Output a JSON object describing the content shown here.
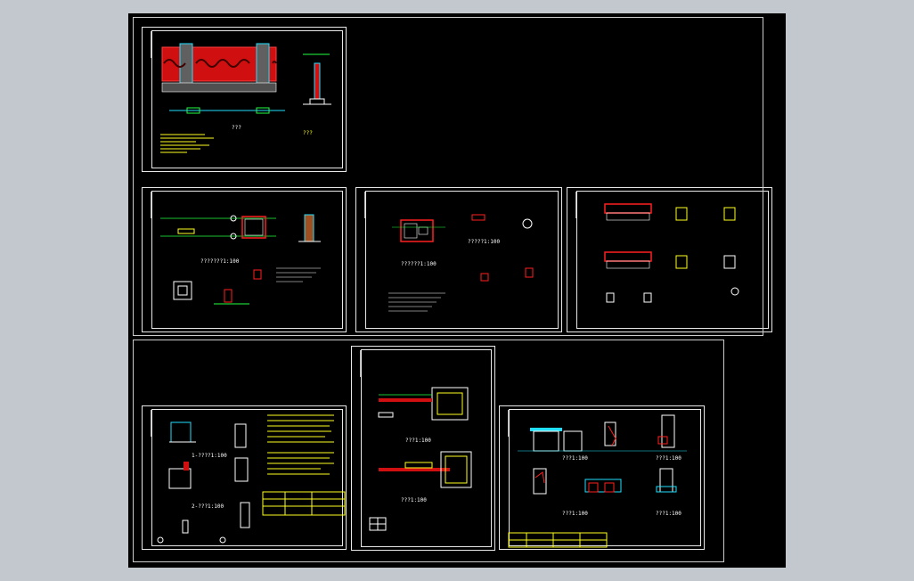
{
  "viewport": {
    "background": "#000000",
    "app_background": "#c3c8cf"
  },
  "colors": {
    "line": "#ffffff",
    "accent_red": "#ff2020",
    "accent_green": "#20ff40",
    "accent_cyan": "#20e0ff",
    "accent_yellow": "#ffff20",
    "accent_magenta": "#ff40ff"
  },
  "sheets": [
    {
      "id": "s1",
      "scale_label": "???",
      "note": "???"
    },
    {
      "id": "s2",
      "scale_label": "???????1:100"
    },
    {
      "id": "s3",
      "scale_label": "??????1:100",
      "scale_label_2": "?????1:100"
    },
    {
      "id": "s4"
    },
    {
      "id": "s5",
      "scale_label": "1-????1:100",
      "scale_label_2": "2-???1:100"
    },
    {
      "id": "s6",
      "scale_label": "???1:100",
      "scale_label_2": "???1:100"
    },
    {
      "id": "s7",
      "scale_label": "???1:100",
      "scale_label_2": "???1:100",
      "scale_label_3": "???1:100",
      "scale_label_4": "???1:100"
    }
  ]
}
